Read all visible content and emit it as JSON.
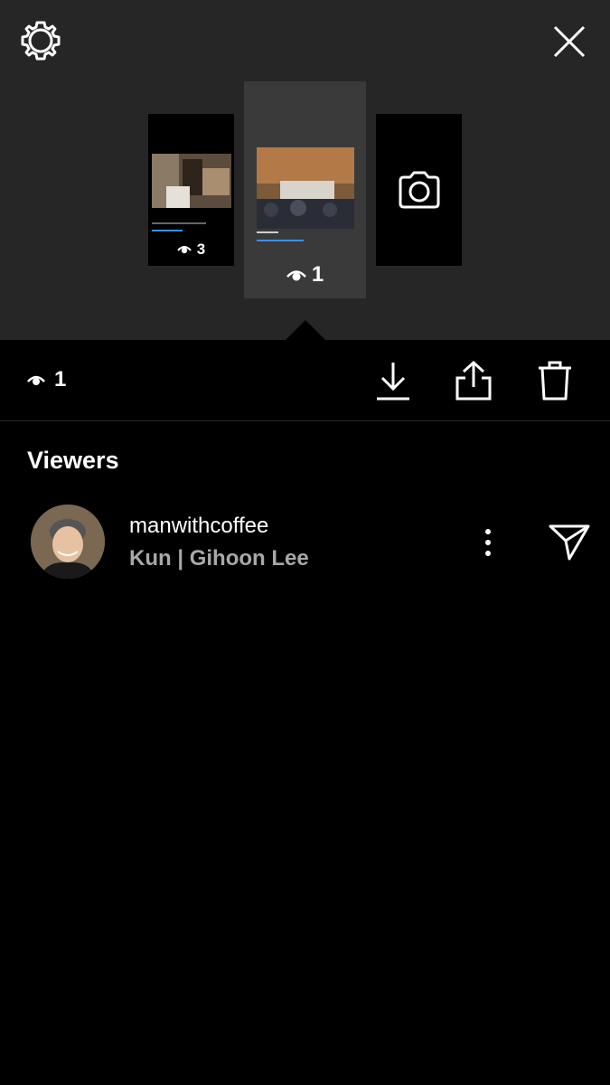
{
  "icons": {
    "settings": "gear-icon",
    "close": "close-icon",
    "camera": "camera-icon",
    "eye": "eye-icon",
    "download": "download-icon",
    "share": "share-icon",
    "trash": "trash-icon",
    "more": "more-vertical-icon",
    "send": "send-icon"
  },
  "stories": {
    "left": {
      "views": "3",
      "link_text": "#MANWITHCOFFEE"
    },
    "center": {
      "views": "1",
      "caption": "@kecc.ffee",
      "link_text": "@MANWITHCOFFEE"
    }
  },
  "toolbar": {
    "view_count": "1"
  },
  "viewers": {
    "title": "Viewers",
    "items": [
      {
        "username": "manwithcoffee",
        "full_name": "Kun | Gihoon Lee"
      }
    ]
  },
  "colors": {
    "top_background": "#262626",
    "background": "#000000",
    "secondary_text": "#a8a8a8",
    "link": "#3d8ef7"
  }
}
